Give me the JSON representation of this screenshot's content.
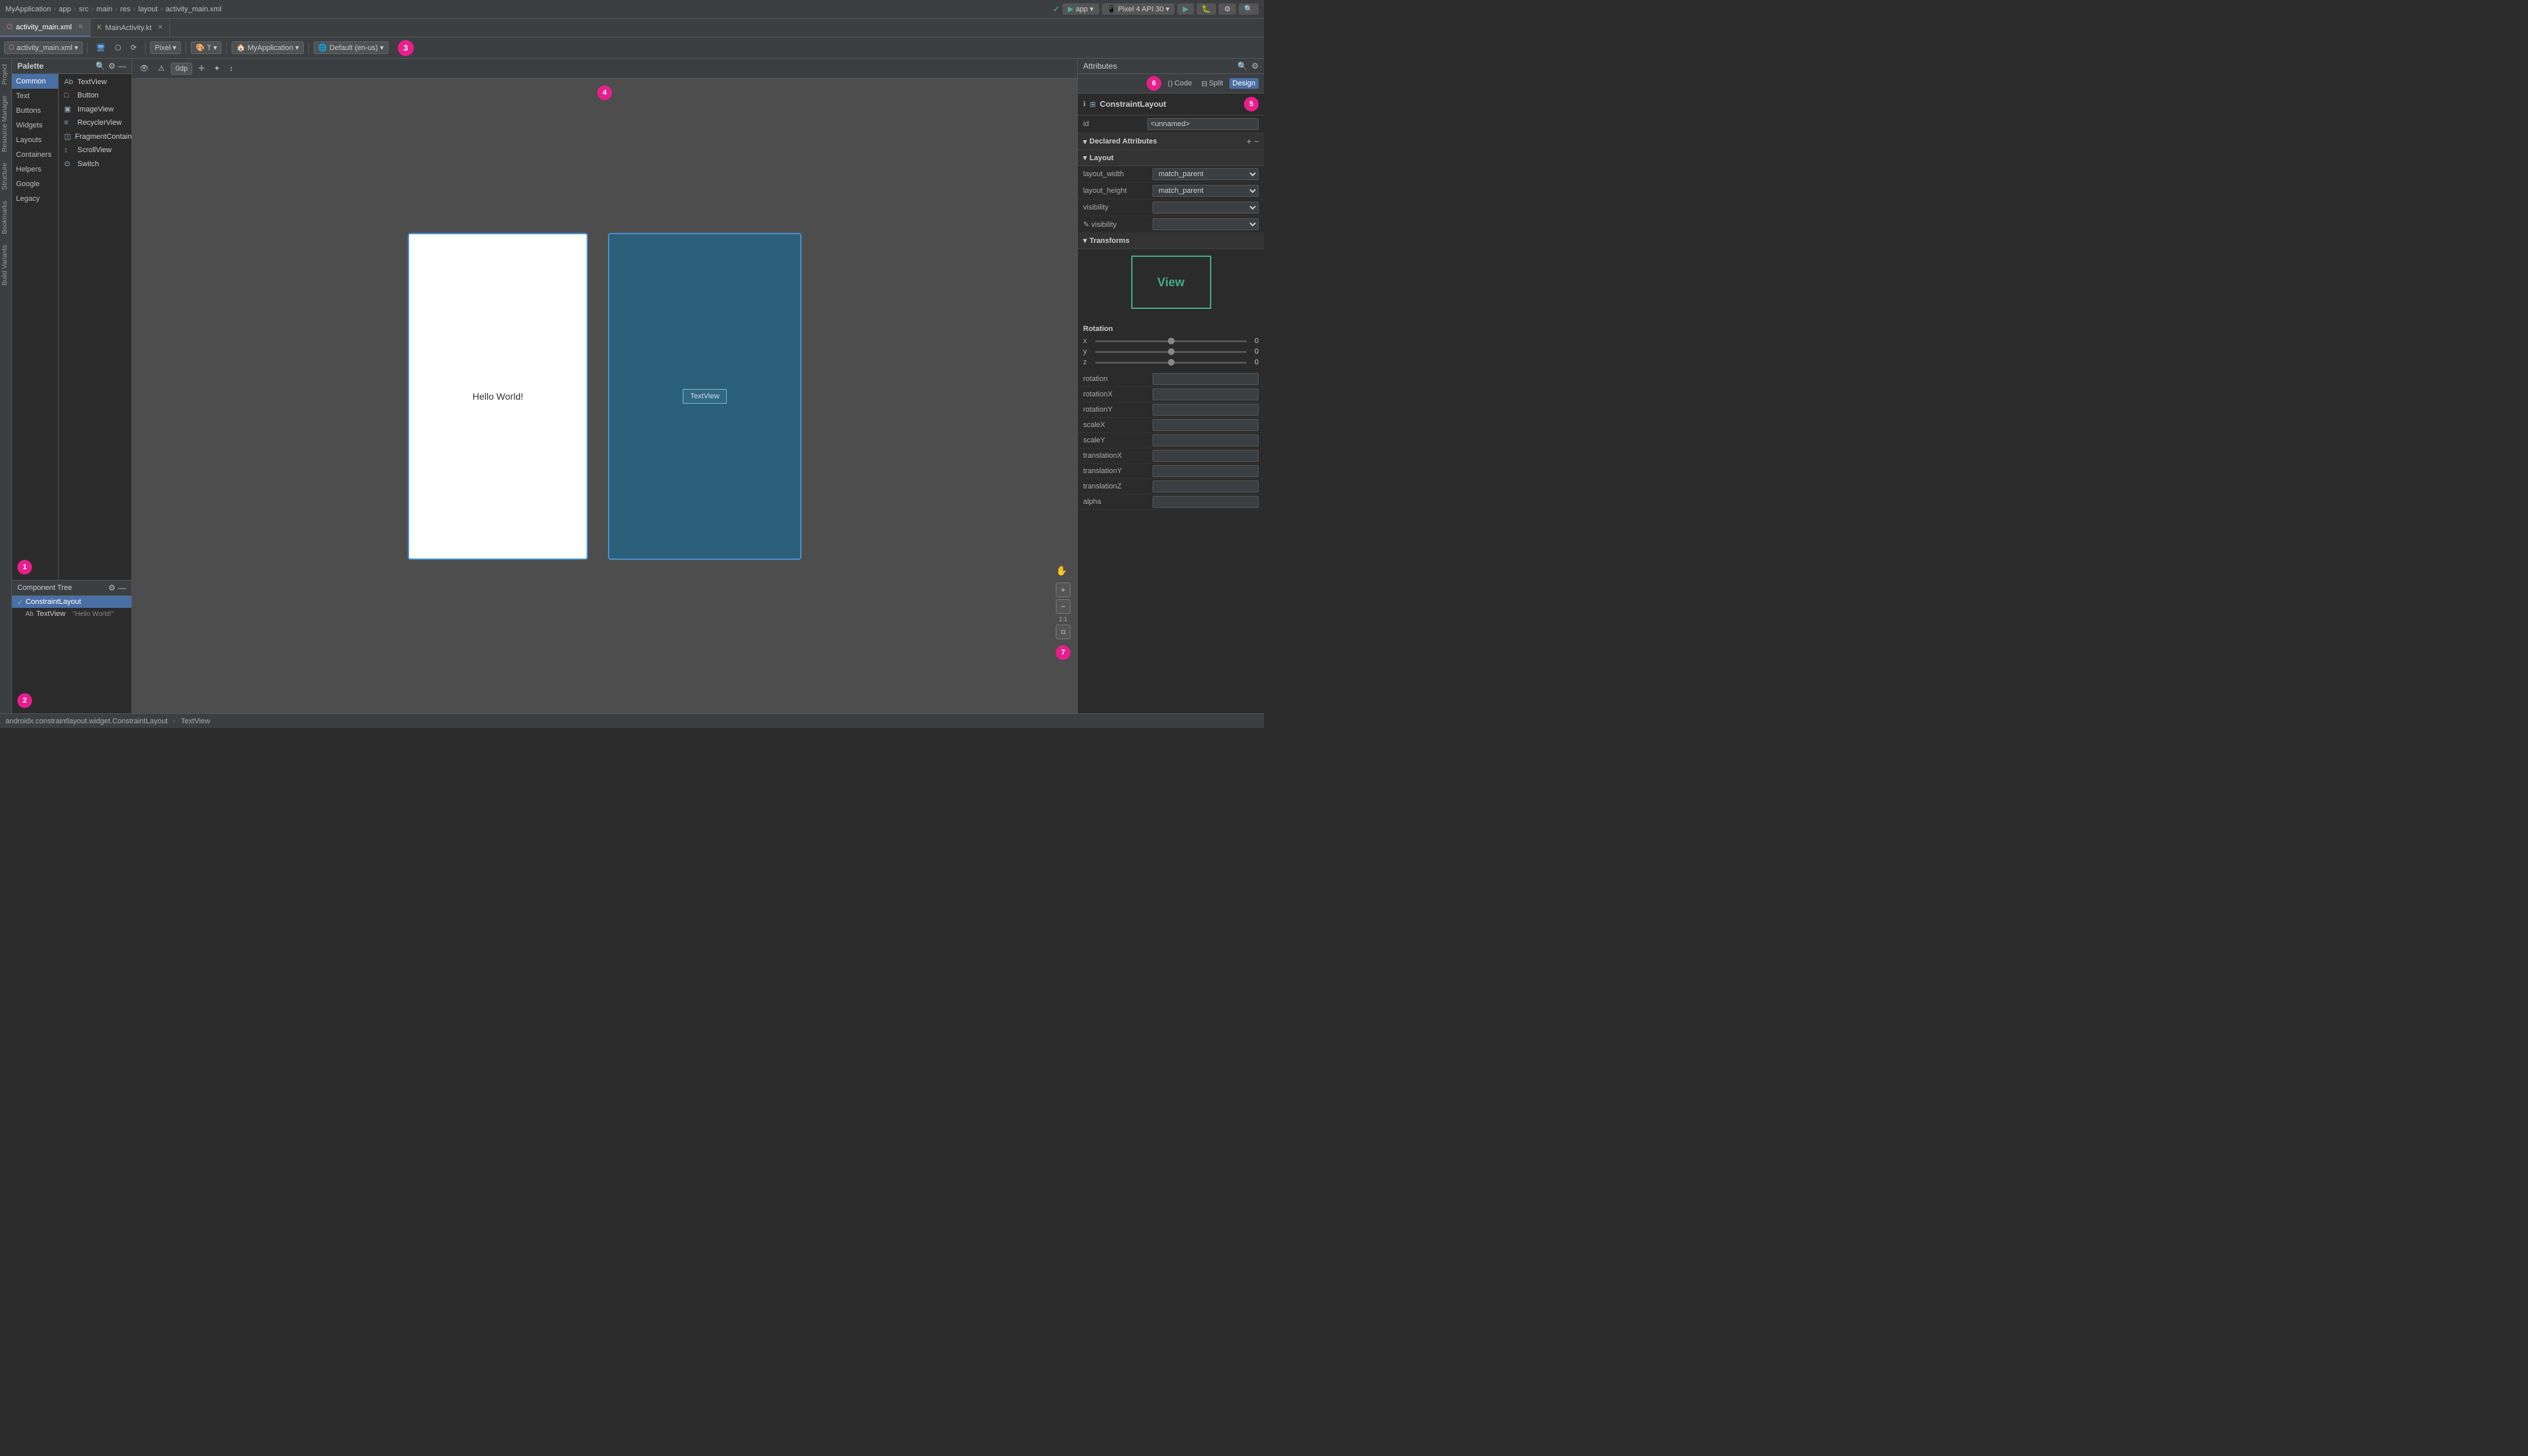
{
  "titlebar": {
    "breadcrumbs": [
      "MyApplication",
      "app",
      "src",
      "main",
      "res",
      "layout",
      "activity_main.xml"
    ],
    "run_config": "app",
    "device": "Pixel 4 API 30"
  },
  "tabs": [
    {
      "label": "activity_main.xml",
      "icon": "xml",
      "active": true
    },
    {
      "label": "MainActivity.kt",
      "icon": "kt",
      "active": false
    }
  ],
  "toolbar": {
    "file_dropdown": "activity_main.xml",
    "pixel_label": "Pixel",
    "t_label": "T",
    "app_label": "MyApplication",
    "locale_label": "Default (en-us)",
    "number3_badge": "3",
    "dp_value": "0dp"
  },
  "palette": {
    "title": "Palette",
    "categories": [
      {
        "label": "Common",
        "active": true
      },
      {
        "label": "Text"
      },
      {
        "label": "Buttons"
      },
      {
        "label": "Widgets"
      },
      {
        "label": "Layouts"
      },
      {
        "label": "Containers"
      },
      {
        "label": "Helpers"
      },
      {
        "label": "Google"
      },
      {
        "label": "Legacy"
      }
    ],
    "items": [
      {
        "label": "TextView",
        "icon": "Ab"
      },
      {
        "label": "Button",
        "icon": "□"
      },
      {
        "label": "ImageView",
        "icon": "▣"
      },
      {
        "label": "RecyclerView",
        "icon": "≡"
      },
      {
        "label": "FragmentContainerView",
        "icon": "◫"
      },
      {
        "label": "ScrollView",
        "icon": "↕"
      },
      {
        "label": "Switch",
        "icon": "⊙"
      }
    ],
    "badge_number": "1"
  },
  "component_tree": {
    "title": "Component Tree",
    "items": [
      {
        "label": "ConstraintLayout",
        "icon": "↙",
        "level": 0,
        "selected": true
      },
      {
        "label": "TextView",
        "prefix": "Ab",
        "suffix": "\"Hello World!\"",
        "level": 1,
        "selected": false
      }
    ],
    "badge_number": "2"
  },
  "canvas": {
    "design_view": {
      "text": "Hello World!"
    },
    "blueprint_view": {
      "label": "TextView"
    },
    "badge_number": "4",
    "zoom_label": "1:1",
    "controls": [
      "+",
      "-"
    ]
  },
  "attributes_panel": {
    "title": "Attributes",
    "component_type": "ConstraintLayout",
    "id_label": "id",
    "id_value": "<unnamed>",
    "declared_attributes_label": "Declared Attributes",
    "badge_number": "5",
    "layout_section": {
      "title": "Layout",
      "fields": [
        {
          "label": "layout_width",
          "value": "match_parent",
          "type": "select"
        },
        {
          "label": "layout_height",
          "value": "match_parent",
          "type": "select"
        },
        {
          "label": "visibility",
          "value": "",
          "type": "select"
        },
        {
          "label": "✎ visibility",
          "value": "",
          "type": "select"
        }
      ]
    },
    "transforms_section": {
      "title": "Transforms",
      "preview_text": "View",
      "rotation": {
        "title": "Rotation",
        "axes": [
          {
            "axis": "x",
            "value": "0"
          },
          {
            "axis": "y",
            "value": "0"
          },
          {
            "axis": "z",
            "value": "0"
          }
        ]
      },
      "fields": [
        {
          "label": "rotation",
          "value": ""
        },
        {
          "label": "rotationX",
          "value": ""
        },
        {
          "label": "rotationY",
          "value": ""
        },
        {
          "label": "scaleX",
          "value": ""
        },
        {
          "label": "scaleY",
          "value": ""
        },
        {
          "label": "translationX",
          "value": ""
        },
        {
          "label": "translationY",
          "value": ""
        },
        {
          "label": "translationZ",
          "value": ""
        },
        {
          "label": "alpha",
          "value": ""
        }
      ]
    },
    "code_tab": "Code",
    "split_tab": "Split",
    "design_tab": "Design",
    "number6_badge": "6",
    "number7_badge": "7"
  },
  "status_bar": {
    "class_path": "androidx.constraintlayout.widget.ConstraintLayout",
    "separator": "›",
    "element": "TextView"
  }
}
